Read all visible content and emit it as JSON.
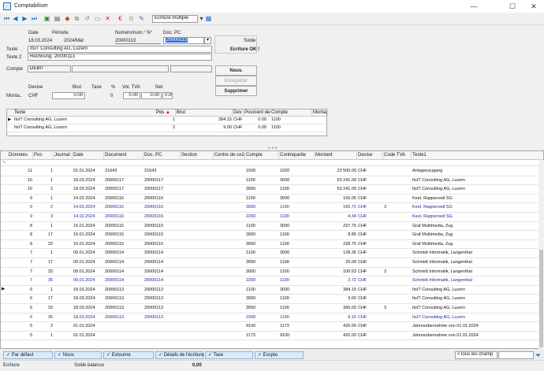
{
  "window": {
    "title": "Comptabiliser",
    "min": "—",
    "max": "☐",
    "close": "✕"
  },
  "toolbar": {
    "dropdown": "Ecriture multiple"
  },
  "header": {
    "date_label": "Date",
    "periode_label": "Période",
    "num_label": "Numéro/num.° N°",
    "docpc_label": "Doc. PC",
    "date": "18.03.2024",
    "periode": "2024/Mär",
    "num": "20000113",
    "docpc": "20000113",
    "solde_label": "Solde",
    "ecriture_ok": "Ecriture OK !",
    "texte_label": "Texte",
    "texte": "ItsIT Consulting AG, Luzern",
    "texte2_label": "Texte 2",
    "texte2": "Rechnung: 20000113",
    "compte_label": "Compte",
    "compte": "DEBIT",
    "devise_label": "Devise",
    "brut_label": "Brut",
    "taxe_label": "Taxe",
    "pct_label": "%",
    "voltva_label": "Vol. TVA",
    "net_label": "Net",
    "montant_label": "Monta..",
    "devise": "CHF",
    "brut": "0.00",
    "taxe": "0",
    "pct": "0.00",
    "voltva": "0.00",
    "net": "0.00"
  },
  "buttons": {
    "nouv": "Nouv.",
    "enregistrer": "Enregistrer",
    "supprimer": "Supprimer"
  },
  "lines": {
    "headers": [
      "Texte",
      "Pos",
      "Brut",
      "Dev",
      "Pourcent de t",
      "Compte",
      "Monta.."
    ],
    "rows": [
      {
        "texte": "ItsIT Consulting AG, Luzern",
        "pos": "1",
        "brut": "384.15",
        "dev": "CHF",
        "pct": "0.00",
        "compte": "1100"
      },
      {
        "texte": "ItsIT Consulting AG, Luzern",
        "pos": "2",
        "brut": "9.00",
        "dev": "CHF",
        "pct": "0.00",
        "compte": "1100"
      }
    ]
  },
  "journal": {
    "headers": [
      "Données",
      "Pos",
      "Journal",
      "Date",
      "Document",
      "Doc. PC",
      "Section",
      "Centre de coût",
      "Compte",
      "Contrepartie",
      "Montant",
      "Devise",
      "Code TVA",
      "Texte1"
    ],
    "rows": [
      {
        "d": "11",
        "p": "1",
        "j": "01.01.2024",
        "doc": "21643",
        "pc": "21643",
        "cpt": "1500",
        "cp": "1020",
        "m": "23 500.00",
        "dev": "CHF",
        "tva": "",
        "t": "Anlagenzugang",
        "blue": false
      },
      {
        "d": "10",
        "p": "1",
        "j": "18.03.2024",
        "doc": "20000117",
        "pc": "20000117",
        "cpt": "1100",
        "cp": "3000",
        "m": "53 241.00",
        "dev": "CHF",
        "tva": "",
        "t": "ItsIT Consulting AG, Luzern",
        "blue": false
      },
      {
        "d": "10",
        "p": "2",
        "j": "18.03.2024",
        "doc": "20000117",
        "pc": "20000117",
        "cpt": "3000",
        "cp": "1100",
        "m": "53 241.00",
        "dev": "CHF",
        "tva": "",
        "t": "ItsIT Consulting AG, Luzern",
        "blue": false
      },
      {
        "d": "9",
        "p": "1",
        "j": "14.02.2024",
        "doc": "20000116",
        "pc": "20000116",
        "cpt": "1100",
        "cp": "3000",
        "m": "165.05",
        "dev": "CHF",
        "tva": "",
        "t": "Keel. Rapperswil SG",
        "blue": false
      },
      {
        "d": "9",
        "p": "2",
        "j": "14.02.2024",
        "doc": "20000116",
        "pc": "20000116",
        "cpt": "3000",
        "cp": "1100",
        "m": "165.71",
        "dev": "CHF",
        "tva": "3",
        "t": "Keel. Rapperswil SG",
        "blue": true
      },
      {
        "d": "9",
        "p": "3",
        "j": "14.02.2024",
        "doc": "20000116",
        "pc": "20000116",
        "cpt": "2200",
        "cp": "1100",
        "m": "4.34",
        "dev": "CHF",
        "tva": "",
        "t": "Keel. Rapperswil SG",
        "blue": true
      },
      {
        "d": "8",
        "p": "1",
        "j": "16.01.2024",
        "doc": "20000115",
        "pc": "20000115",
        "cpt": "1100",
        "cp": "3000",
        "m": "237.75",
        "dev": "CHF",
        "tva": "",
        "t": "Graf Multimedia, Zug",
        "blue": false
      },
      {
        "d": "8",
        "p": "17",
        "j": "16.01.2024",
        "doc": "20000115",
        "pc": "20000115",
        "cpt": "3000",
        "cp": "1100",
        "m": "8.85",
        "dev": "CHF",
        "tva": "",
        "t": "Graf Multimedia, Zug",
        "blue": false
      },
      {
        "d": "8",
        "p": "33",
        "j": "16.01.2024",
        "doc": "20000115",
        "pc": "20000115",
        "cpt": "3000",
        "cp": "1100",
        "m": "228.75",
        "dev": "CHF",
        "tva": "",
        "t": "Graf Multimedia, Zug",
        "blue": false
      },
      {
        "d": "7",
        "p": "1",
        "j": "09.01.2024",
        "doc": "20000114",
        "pc": "20000114",
        "cpt": "1100",
        "cp": "3000",
        "m": "128.35",
        "dev": "CHF",
        "tva": "",
        "t": "Schmidt Informatik, Langenthal",
        "blue": false
      },
      {
        "d": "7",
        "p": "17",
        "j": "09.01.2024",
        "doc": "20000114",
        "pc": "20000114",
        "cpt": "3000",
        "cp": "1100",
        "m": "25.00",
        "dev": "CHF",
        "tva": "",
        "t": "Schmidt Informatik, Langenthal",
        "blue": false
      },
      {
        "d": "7",
        "p": "33",
        "j": "09.01.2024",
        "doc": "20000114",
        "pc": "20000114",
        "cpt": "3000",
        "cp": "1100",
        "m": "100.63",
        "dev": "CHF",
        "tva": "3",
        "t": "Schmidt Informatik, Langenthal",
        "blue": false
      },
      {
        "d": "7",
        "p": "35",
        "j": "09.01.2024",
        "doc": "20000114",
        "pc": "20000114",
        "cpt": "2200",
        "cp": "1100",
        "m": "2.72",
        "dev": "CHF",
        "tva": "",
        "t": "Schmidt Informatik, Langenthal",
        "blue": true
      },
      {
        "d": "6",
        "p": "1",
        "j": "18.03.2024",
        "doc": "20000113",
        "pc": "20000113",
        "cpt": "1100",
        "cp": "3000",
        "m": "384.15",
        "dev": "CHF",
        "tva": "",
        "t": "ItsIT Consulting AG, Luzern",
        "blue": false,
        "cur": true
      },
      {
        "d": "6",
        "p": "17",
        "j": "18.03.2024",
        "doc": "20000113",
        "pc": "20000113",
        "cpt": "3000",
        "cp": "1100",
        "m": "9.00",
        "dev": "CHF",
        "tva": "",
        "t": "ItsIT Consulting AG, Luzern",
        "blue": false
      },
      {
        "d": "6",
        "p": "33",
        "j": "18.03.2024",
        "doc": "20000113",
        "pc": "20000113",
        "cpt": "3000",
        "cp": "1100",
        "m": "366.00",
        "dev": "CHF",
        "tva": "3",
        "t": "ItsIT Consulting AG, Luzern",
        "blue": false
      },
      {
        "d": "6",
        "p": "35",
        "j": "18.03.2024",
        "doc": "20000113",
        "pc": "20000113",
        "cpt": "2200",
        "cp": "1100",
        "m": "9.15",
        "dev": "CHF",
        "tva": "",
        "t": "ItsIT Consulting AG, Luzern",
        "blue": true
      },
      {
        "d": "5",
        "p": "2",
        "j": "01.01.2024",
        "doc": "",
        "pc": "",
        "cpt": "9100",
        "cp": "1173",
        "m": "420.00",
        "dev": "CHF",
        "tva": "",
        "t": "Jahresübernahme von 01.01.2024",
        "blue": false
      },
      {
        "d": "5",
        "p": "1",
        "j": "01.01.2024",
        "doc": "",
        "pc": "",
        "cpt": "1173",
        "cp": "9100",
        "m": "420.00",
        "dev": "CHF",
        "tva": "",
        "t": "Jahresübernahme von 01.01.2024",
        "blue": false
      }
    ]
  },
  "bottom": {
    "par_defaut": "Par défaut",
    "nouv": "Nouv.",
    "extourne": "Extourne",
    "details": "Détails de l'écriture",
    "taxe": "Taxe",
    "escpte": "Escpte",
    "filter": "<Tous les champ"
  },
  "status": {
    "ecriture": "Ecriture",
    "solde_balance": "Solde balance",
    "value": "0,00"
  }
}
